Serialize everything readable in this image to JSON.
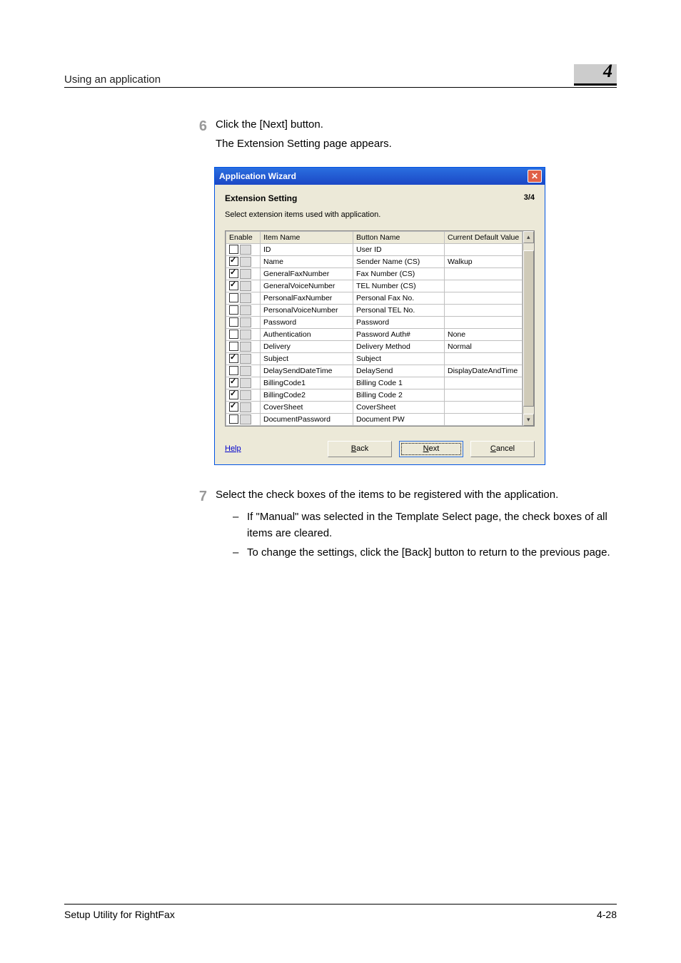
{
  "header": {
    "title": "Using an application",
    "chapter": "4"
  },
  "steps": {
    "s6": {
      "num": "6",
      "line1": "Click the [Next] button.",
      "line2": "The Extension Setting page appears."
    },
    "s7": {
      "num": "7",
      "line1": "Select the check boxes of the items to be registered with the application.",
      "b1": "If \"Manual\" was selected in the Template Select page, the check boxes of all items are cleared.",
      "b2": "To change the settings, click the [Back] button to return to the previous page."
    }
  },
  "dialog": {
    "title": "Application Wizard",
    "heading": "Extension Setting",
    "page_indicator": "3/4",
    "desc": "Select extension items used with application.",
    "columns": {
      "enable": "Enable",
      "item": "Item Name",
      "button": "Button Name",
      "default": "Current Default Value"
    },
    "rows": [
      {
        "checked": false,
        "item": "ID",
        "button": "User ID",
        "def": ""
      },
      {
        "checked": true,
        "item": "Name",
        "button": "Sender Name (CS)",
        "def": "Walkup"
      },
      {
        "checked": true,
        "item": "GeneralFaxNumber",
        "button": "Fax Number (CS)",
        "def": ""
      },
      {
        "checked": true,
        "item": "GeneralVoiceNumber",
        "button": "TEL Number (CS)",
        "def": ""
      },
      {
        "checked": false,
        "item": "PersonalFaxNumber",
        "button": "Personal Fax No.",
        "def": ""
      },
      {
        "checked": false,
        "item": "PersonalVoiceNumber",
        "button": "Personal TEL No.",
        "def": ""
      },
      {
        "checked": false,
        "item": "Password",
        "button": "Password",
        "def": ""
      },
      {
        "checked": false,
        "item": "Authentication",
        "button": "Password Auth#",
        "def": "None"
      },
      {
        "checked": false,
        "item": "Delivery",
        "button": "Delivery Method",
        "def": "Normal"
      },
      {
        "checked": true,
        "item": "Subject",
        "button": "Subject",
        "def": ""
      },
      {
        "checked": false,
        "item": "DelaySendDateTime",
        "button": "DelaySend",
        "def": "DisplayDateAndTime"
      },
      {
        "checked": true,
        "item": "BillingCode1",
        "button": "Billing Code 1",
        "def": ""
      },
      {
        "checked": true,
        "item": "BillingCode2",
        "button": "Billing Code 2",
        "def": ""
      },
      {
        "checked": true,
        "item": "CoverSheet",
        "button": "CoverSheet",
        "def": ""
      },
      {
        "checked": false,
        "item": "DocumentPassword",
        "button": "Document PW",
        "def": ""
      }
    ],
    "help": "Help",
    "back": "Back",
    "next": "Next",
    "cancel": "Cancel"
  },
  "footer": {
    "left": "Setup Utility for RightFax",
    "right": "4-28"
  }
}
